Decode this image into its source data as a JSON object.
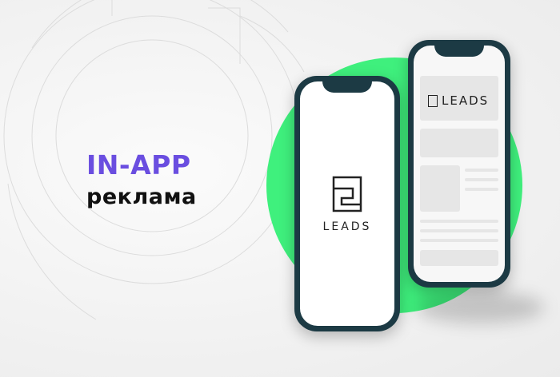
{
  "headline": {
    "title": "IN-APP",
    "subtitle": "реклама"
  },
  "back_phone": {
    "logo_text": "LEADS"
  },
  "front_phone": {
    "logo_text": "LEADS"
  },
  "colors": {
    "accent": "#6a4ee0",
    "circle": "#3ff07d",
    "phone_frame": "#1c3a44",
    "text_dark": "#111111"
  }
}
